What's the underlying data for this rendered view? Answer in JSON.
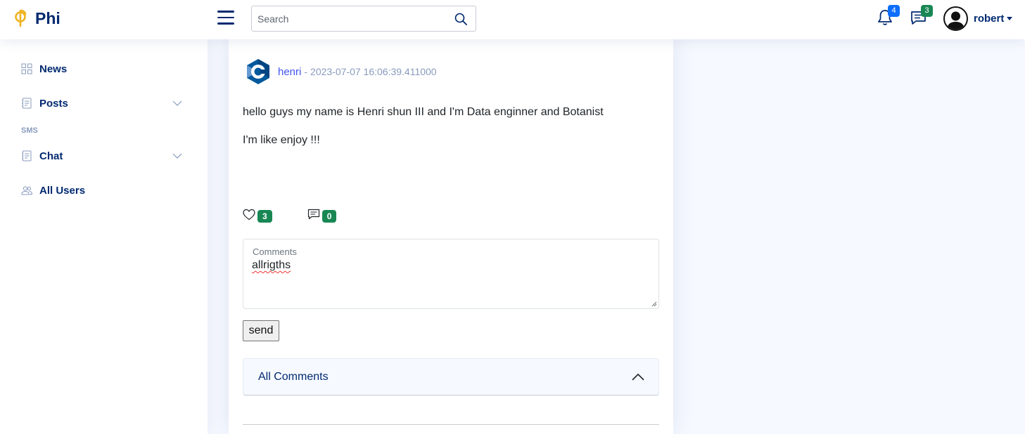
{
  "header": {
    "brand": "Phi",
    "search_placeholder": "Search",
    "notifications_count": "4",
    "messages_count": "3",
    "username": "robert",
    "colors": {
      "notif_badge": "#0d6efd",
      "msg_badge": "#198754"
    }
  },
  "sidebar": {
    "items": [
      {
        "label": "News",
        "icon": "grid-icon"
      },
      {
        "label": "Posts",
        "icon": "journal-icon"
      },
      {
        "label": "Chat",
        "icon": "journal-icon"
      },
      {
        "label": "All Users",
        "icon": "people-icon"
      }
    ],
    "section_heading": "SMS"
  },
  "post": {
    "author": "henri",
    "separator": "-",
    "date": "2023-07-07 16:06:39.411000",
    "body_line1": "hello guys my name is Henri shun III and I'm Data enginner and Botanist",
    "body_line2": "I'm like enjoy !!!",
    "likes": "3",
    "comments_count": "0"
  },
  "comment_form": {
    "label": "Comments",
    "value": "allrigths",
    "send_label": "send"
  },
  "accordion": {
    "title": "All Comments"
  }
}
